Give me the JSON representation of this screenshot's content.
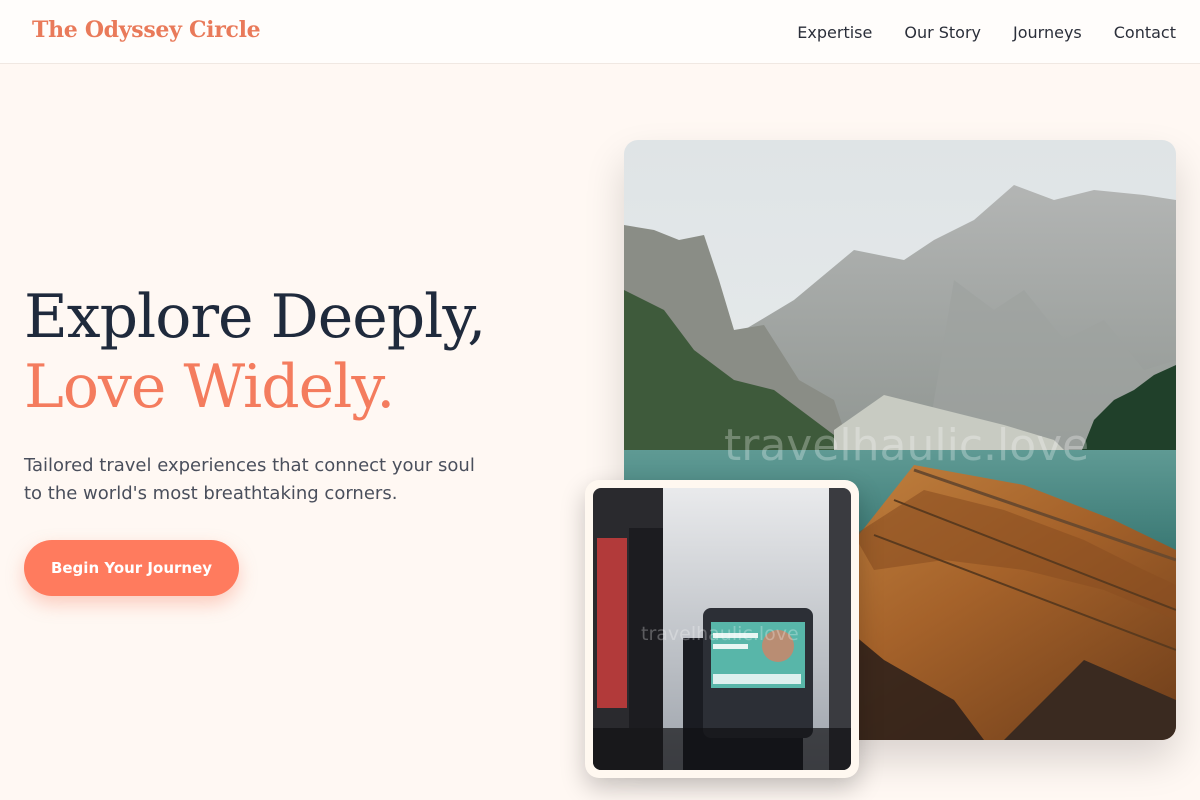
{
  "brand": {
    "name": "The Odyssey Circle"
  },
  "nav": {
    "links": [
      "Expertise",
      "Our Story",
      "Journeys",
      "Contact"
    ]
  },
  "hero": {
    "title_line1": "Explore Deeply,",
    "title_line2": "Love Widely.",
    "subtitle": "Tailored travel experiences that connect your soul to the world's most breathtaking corners.",
    "cta_label": "Begin Your Journey"
  },
  "images": {
    "main": {
      "subject": "mountain lake with wooden boat bow",
      "watermark": "travelhaulic.love"
    },
    "secondary": {
      "subject": "airplane seat-back entertainment screen",
      "watermark": "travelhaulic.love"
    }
  },
  "colors": {
    "accent": "#f47c5e",
    "cta": "#ff7b5e",
    "heading": "#1f2a3c",
    "background": "#fff8f3"
  }
}
